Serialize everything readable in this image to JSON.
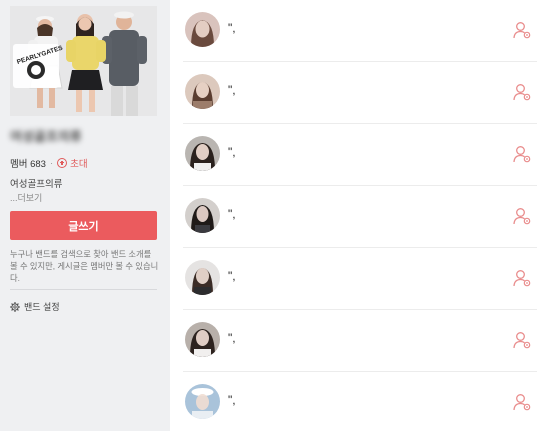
{
  "band": {
    "name": "여성골프의류",
    "member_label": "멤버 683",
    "dot": "·",
    "invite_label": "초대",
    "description": "여성골프의류",
    "more_label": "...더보기",
    "write_button": "글쓰기",
    "notice": "누구나 밴드를 검색으로 찾아 밴드 소개를 볼 수 있지만, 게시글은 멤버만 볼 수 있습니다.",
    "settings_label": "밴드 설정",
    "cover_logo_text": "PEARLYGATES"
  },
  "colors": {
    "accent": "#eb5b5e",
    "sidebar_bg": "#eff0f2"
  },
  "posts": [
    {
      "text": "\","
    },
    {
      "text": "\","
    },
    {
      "text": "\","
    },
    {
      "text": "\","
    },
    {
      "text": "\","
    },
    {
      "text": "\","
    },
    {
      "text": "\","
    }
  ],
  "icons": {
    "post_action": "member-settings-icon",
    "invite": "plus-circle-icon",
    "settings": "gear-icon"
  }
}
